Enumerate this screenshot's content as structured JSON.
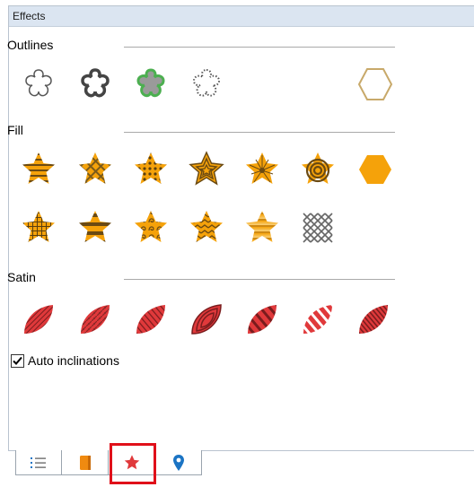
{
  "panel": {
    "title": "Effects"
  },
  "sections": {
    "outlines": {
      "label": "Outlines"
    },
    "fill": {
      "label": "Fill"
    },
    "satin": {
      "label": "Satin"
    }
  },
  "outline_icons": [
    "outline-flower-thin-icon",
    "outline-flower-bold-icon",
    "outline-flower-green-icon",
    "outline-flower-dotted-icon",
    "outline-hexagon-icon"
  ],
  "fill_icons_row1": [
    "fill-star-stripes-icon",
    "fill-star-weave-icon",
    "fill-star-dots-icon",
    "fill-star-concentric-icon",
    "fill-star-radial-icon",
    "fill-star-spiral-icon",
    "fill-hexagon-icon"
  ],
  "fill_icons_row2": [
    "fill-star-grid-icon",
    "fill-star-wide-stripes-icon",
    "fill-star-swirl-icon",
    "fill-star-zigzag-icon",
    "fill-star-gradient-stripes-icon",
    "fill-crosshatch-icon"
  ],
  "satin_icons": [
    "satin-leaf-diagonal-icon",
    "satin-leaf-pattern-icon",
    "satin-leaf-stripes-icon",
    "satin-leaf-contour-icon",
    "satin-leaf-wide-stripes-icon",
    "satin-leaf-white-stripes-icon",
    "satin-leaf-dense-stripes-icon"
  ],
  "options": {
    "auto_inclinations_label": "Auto inclinations",
    "auto_inclinations_checked": true
  },
  "tabs": [
    {
      "name": "list-icon",
      "active": false
    },
    {
      "name": "spool-icon",
      "active": false
    },
    {
      "name": "star-icon",
      "active": true
    },
    {
      "name": "location-pin-icon",
      "active": false
    }
  ],
  "colors": {
    "accent_orange": "#f5a20a",
    "satin_red": "#e0393b",
    "highlight": "#e0101a",
    "outline_green": "#4caf50",
    "hexagon_outline": "#c8a96a",
    "tab_blue": "#1b74c4"
  }
}
